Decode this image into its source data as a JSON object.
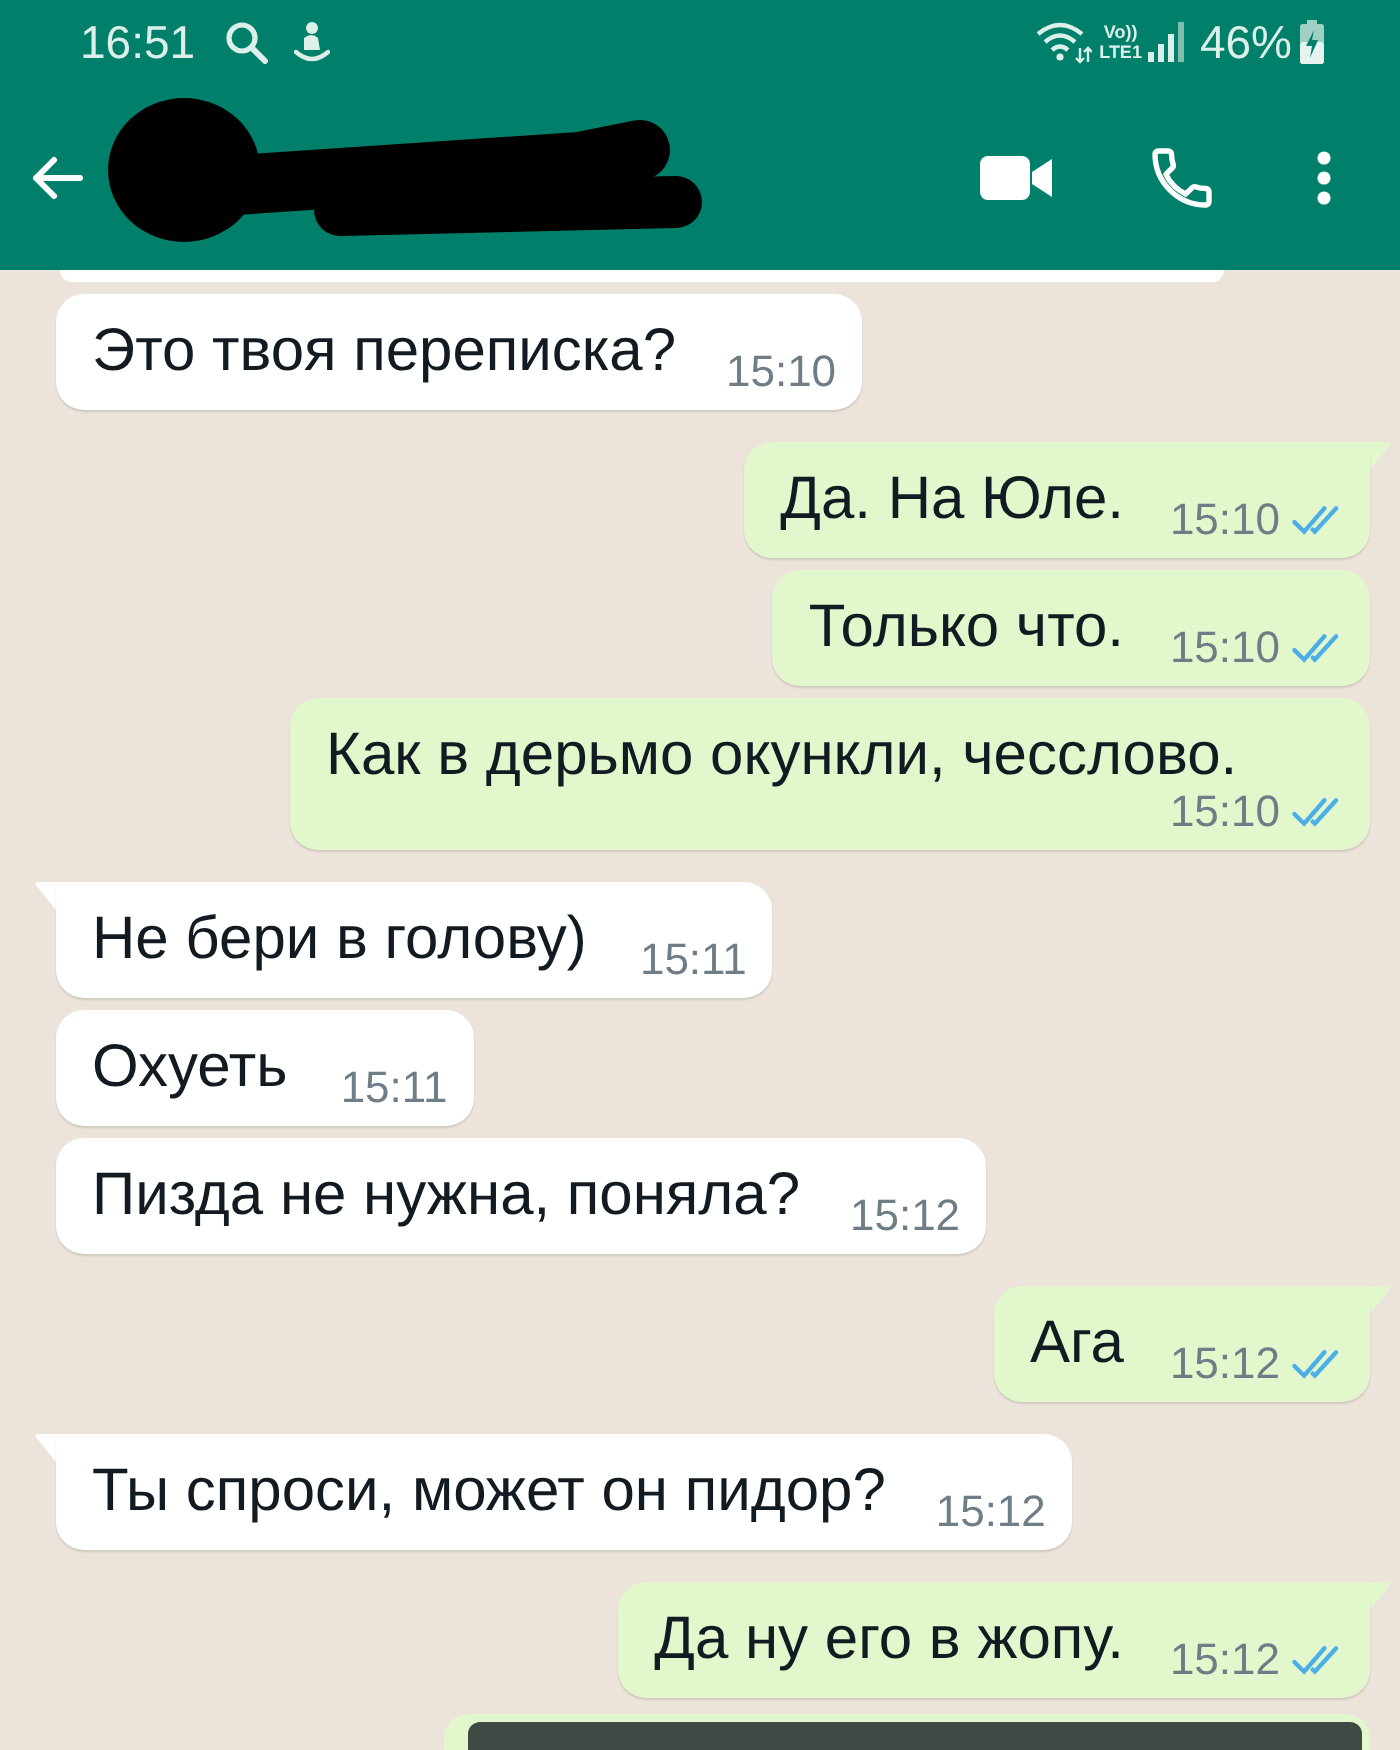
{
  "status_bar": {
    "time": "16:51",
    "network_label": [
      "Vo))",
      "LTE1"
    ],
    "battery": "46%"
  },
  "messages": [
    {
      "kind": "incoming",
      "text": "Это твоя переписка?",
      "time": "15:10",
      "tail": false
    },
    {
      "kind": "outgoing",
      "text": "Да. На Юле.",
      "time": "15:10",
      "tail": true,
      "read": true
    },
    {
      "kind": "outgoing",
      "text": "Только что.",
      "time": "15:10",
      "tail": false,
      "read": true
    },
    {
      "kind": "outgoing",
      "text": "Как в дерьмо окункли, чесслово.",
      "time": "15:10",
      "tail": false,
      "read": true
    },
    {
      "kind": "incoming",
      "text": "Не бери в голову)",
      "time": "15:11",
      "tail": true
    },
    {
      "kind": "incoming",
      "text": "Охуеть",
      "time": "15:11",
      "tail": false
    },
    {
      "kind": "incoming",
      "text": "Пизда не нужна, поняла?",
      "time": "15:12",
      "tail": false
    },
    {
      "kind": "outgoing",
      "text": "Ага",
      "time": "15:12",
      "tail": true,
      "read": true
    },
    {
      "kind": "incoming",
      "text": "Ты спроси, может он пидор?",
      "time": "15:12",
      "tail": true
    },
    {
      "kind": "outgoing",
      "text": "Да ну его в жопу.",
      "time": "15:12",
      "tail": true,
      "read": true
    }
  ]
}
